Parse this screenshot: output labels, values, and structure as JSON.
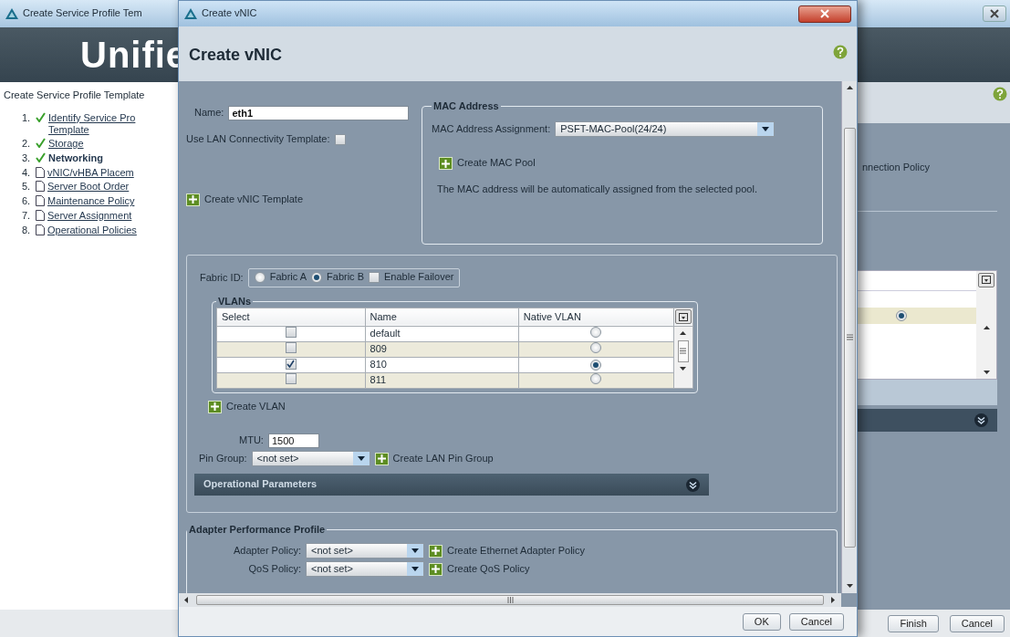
{
  "main_window": {
    "title": "Create Service Profile Tem",
    "header": "Unifie",
    "wizard_title": "Create Service Profile Template",
    "steps": [
      {
        "number": "1.",
        "kind": "done",
        "current": false,
        "lines": [
          "Identify Service Pro",
          "Template"
        ]
      },
      {
        "number": "2.",
        "kind": "done",
        "current": false,
        "lines": [
          "Storage"
        ]
      },
      {
        "number": "3.",
        "kind": "done",
        "current": true,
        "lines": [
          "Networking"
        ]
      },
      {
        "number": "4.",
        "kind": "pending",
        "current": false,
        "lines": [
          "vNIC/vHBA Placem"
        ]
      },
      {
        "number": "5.",
        "kind": "pending",
        "current": false,
        "lines": [
          "Server Boot Order"
        ]
      },
      {
        "number": "6.",
        "kind": "pending",
        "current": false,
        "lines": [
          "Maintenance Policy"
        ]
      },
      {
        "number": "7.",
        "kind": "pending",
        "current": false,
        "lines": [
          "Server Assignment"
        ]
      },
      {
        "number": "8.",
        "kind": "pending",
        "current": false,
        "lines": [
          "Operational Policies"
        ]
      }
    ],
    "partial_text": "nnection Policy",
    "partial_table": {
      "highlighted_row": {
        "native": true
      }
    },
    "buttons": [
      "Finish",
      "Cancel"
    ]
  },
  "dialog": {
    "title": "Create vNIC",
    "heading": "Create vNIC",
    "name": {
      "label": "Name:",
      "value": "eth1"
    },
    "lan_template": {
      "label": "Use LAN Connectivity Template:",
      "checked": false
    },
    "vnic_template_link": "Create vNIC Template",
    "mac": {
      "legend": "MAC Address",
      "label": "MAC Address Assignment:",
      "value": "PSFT-MAC-Pool(24/24)",
      "link": "Create MAC Pool",
      "note": "The MAC address will be automatically assigned from the selected pool."
    },
    "fabric": {
      "label": "Fabric ID:",
      "options": [
        {
          "label": "Fabric A",
          "selected": false
        },
        {
          "label": "Fabric B",
          "selected": true
        }
      ],
      "failover": {
        "label": "Enable Failover",
        "checked": false
      }
    },
    "vlans": {
      "legend": "VLANs",
      "columns": [
        "Select",
        "Name",
        "Native VLAN"
      ],
      "rows": [
        {
          "name": "default",
          "checked": false,
          "native": false
        },
        {
          "name": "809",
          "checked": false,
          "native": false
        },
        {
          "name": "810",
          "checked": true,
          "native": true
        },
        {
          "name": "811",
          "checked": false,
          "native": false
        }
      ],
      "link": "Create VLAN"
    },
    "mtu": {
      "label": "MTU:",
      "value": "1500"
    },
    "pin_group": {
      "label": "Pin Group:",
      "value": "<not set>",
      "link": "Create LAN Pin Group"
    },
    "operational_parameters": "Operational Parameters",
    "adapter": {
      "legend": "Adapter Performance Profile",
      "rows": [
        {
          "label": "Adapter Policy:",
          "value": "<not set>",
          "link": "Create Ethernet Adapter Policy"
        },
        {
          "label": "QoS Policy:",
          "value": "<not set>",
          "link": "Create QoS Policy"
        }
      ]
    },
    "buttons": [
      "OK",
      "Cancel"
    ]
  }
}
